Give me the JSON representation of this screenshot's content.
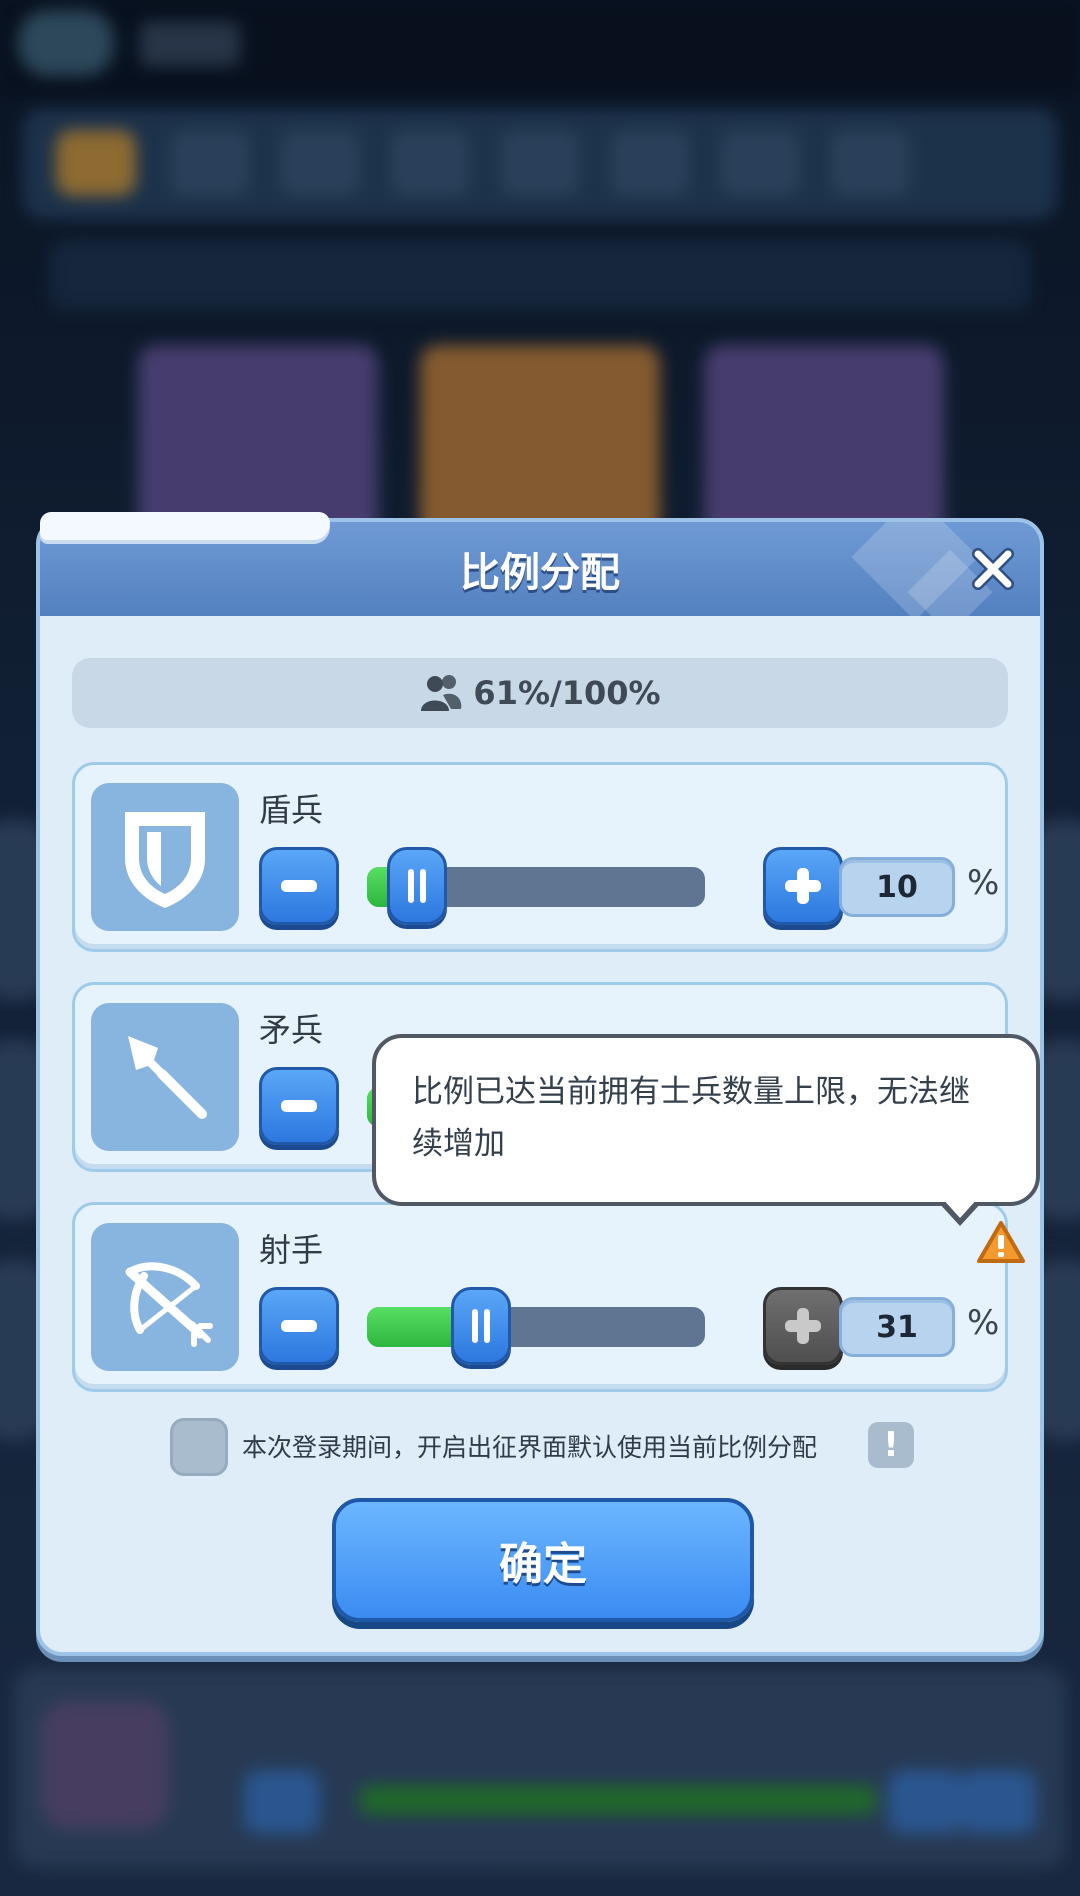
{
  "dialog": {
    "title": "比例分配",
    "capacity": "61%/100%",
    "units": [
      {
        "name": "盾兵",
        "value": "10",
        "percent_sign": "%",
        "fill_fraction": 0.1
      },
      {
        "name": "矛兵",
        "value": "",
        "percent_sign": "",
        "fill_fraction": 0.0
      },
      {
        "name": "射手",
        "value": "31",
        "percent_sign": "%",
        "fill_fraction": 0.31
      }
    ],
    "tooltip": "比例已达当前拥有士兵数量上限，无法继续增加",
    "checkbox_label": "本次登录期间，开启出征界面默认使用当前比例分配",
    "info_label": "!",
    "confirm_label": "确定"
  },
  "icons": {
    "close": "close-icon",
    "capacity": "people-icon",
    "shield": "shield-icon",
    "spear": "spear-icon",
    "crossbow": "crossbow-icon",
    "warning": "warning-icon"
  },
  "colors": {
    "primary_button": "#3b8cf2",
    "slider_fill": "#2fb53f",
    "warning": "#f29a2e",
    "disabled_button": "#4f4f4f"
  }
}
